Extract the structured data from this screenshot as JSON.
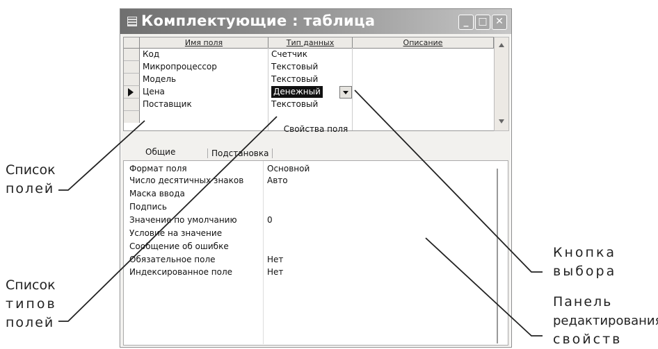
{
  "window": {
    "title": "Комплектующие : таблица",
    "buttons": {
      "minimize": "_",
      "maximize": "□",
      "close": "✕"
    }
  },
  "grid": {
    "headers": [
      "Имя поля",
      "Тип данных",
      "Описание"
    ],
    "rows": [
      {
        "name": "Код",
        "type": "Счетчик"
      },
      {
        "name": "Микропроцессор",
        "type": "Текстовый"
      },
      {
        "name": "Модель",
        "type": "Текстовый"
      },
      {
        "name": "Цена",
        "type": "Денежный"
      },
      {
        "name": "Поставщик",
        "type": "Текстовый"
      }
    ],
    "selected_row_index": 3
  },
  "properties": {
    "section_title": "Свойства поля",
    "tabs": [
      "Общие",
      "Подстановка"
    ],
    "items": [
      {
        "label": "Формат поля",
        "value": "Основной"
      },
      {
        "label": "Число десятичных знаков",
        "value": "Авто"
      },
      {
        "label": "Маска ввода",
        "value": ""
      },
      {
        "label": "Подпись",
        "value": ""
      },
      {
        "label": "Значение по умолчанию",
        "value": "0"
      },
      {
        "label": "Условие на значение",
        "value": ""
      },
      {
        "label": "Сообщение об ошибке",
        "value": ""
      },
      {
        "label": "Обязательное поле",
        "value": "Нет"
      },
      {
        "label": "Индексированное поле",
        "value": "Нет"
      }
    ]
  },
  "callouts": {
    "field_list": [
      "Список",
      "полей"
    ],
    "type_list": [
      "Список",
      "типов",
      "полей"
    ],
    "select_button": [
      "Кнопка",
      "выбора"
    ],
    "edit_panel": [
      "Панель",
      "редактирования",
      "свойств"
    ]
  },
  "colors": {
    "selection": "#111111",
    "titlebar": "#7a7a7a"
  }
}
